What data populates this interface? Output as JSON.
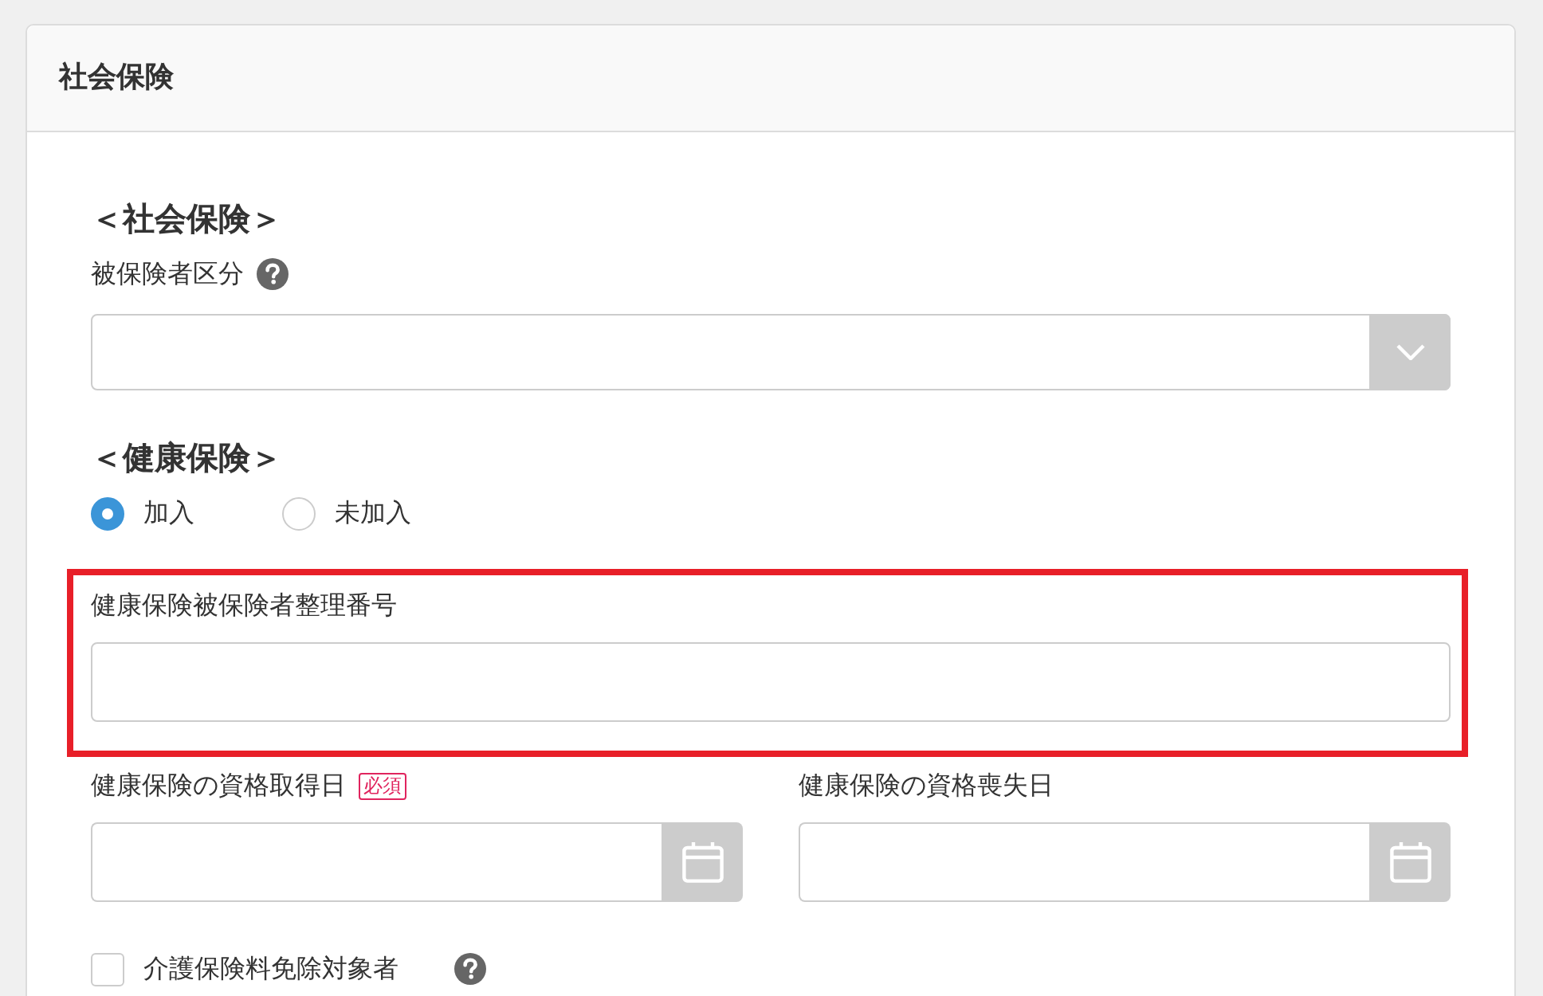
{
  "panel": {
    "title": "社会保険"
  },
  "social_insurance": {
    "heading": "＜社会保険＞",
    "category": {
      "label": "被保険者区分"
    }
  },
  "health_insurance": {
    "heading": "＜健康保険＞",
    "enrollment": [
      {
        "label": "加入",
        "selected": true
      },
      {
        "label": "未加入",
        "selected": false
      }
    ],
    "insured_number": {
      "label": "健康保険被保険者整理番号",
      "highlighted": true
    },
    "dates": [
      {
        "label": "健康保険の資格取得日",
        "badge": "必須"
      },
      {
        "label": "健康保険の資格喪失日"
      }
    ]
  },
  "care_exemption": {
    "label": "介護保険料免除対象者",
    "checked": false
  }
}
